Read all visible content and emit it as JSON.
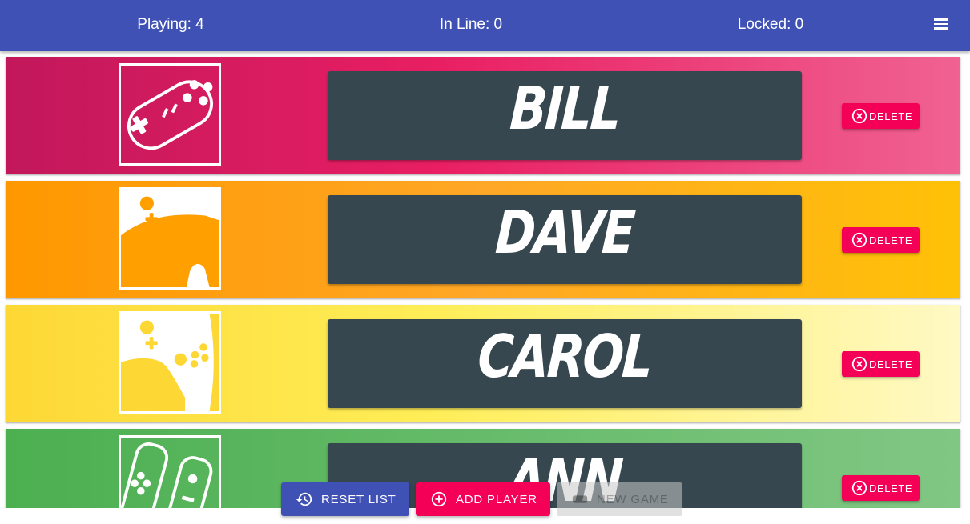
{
  "header": {
    "playing": "Playing: 4",
    "in_line": "In Line: 0",
    "locked": "Locked: 0",
    "menu_icon": "hamburger-menu-icon"
  },
  "players": [
    {
      "name": "Bill",
      "icon": "gamepad-outline-icon",
      "delete_label": "DELETE",
      "gradient": [
        "#c2185b",
        "#e91e63",
        "#f06292"
      ]
    },
    {
      "name": "Dave",
      "icon": "switch-pro-controller-icon",
      "delete_label": "DELETE",
      "gradient": [
        "#ff9800",
        "#ffa726",
        "#ffc107"
      ]
    },
    {
      "name": "Carol",
      "icon": "switch-pro-controller-icon",
      "delete_label": "DELETE",
      "gradient": [
        "#fdd835",
        "#ffee58",
        "#fff9c4"
      ]
    },
    {
      "name": "Ann",
      "icon": "joycon-icon",
      "delete_label": "DELETE",
      "gradient": [
        "#4caf50",
        "#66bb6a",
        "#81c784"
      ]
    }
  ],
  "actions": {
    "reset_label": "RESET LIST",
    "add_label": "ADD PLAYER",
    "new_game_label": "NEW GAME"
  },
  "colors": {
    "primary": "#3f51b5",
    "accent": "#f50057",
    "card": "#37474f"
  }
}
